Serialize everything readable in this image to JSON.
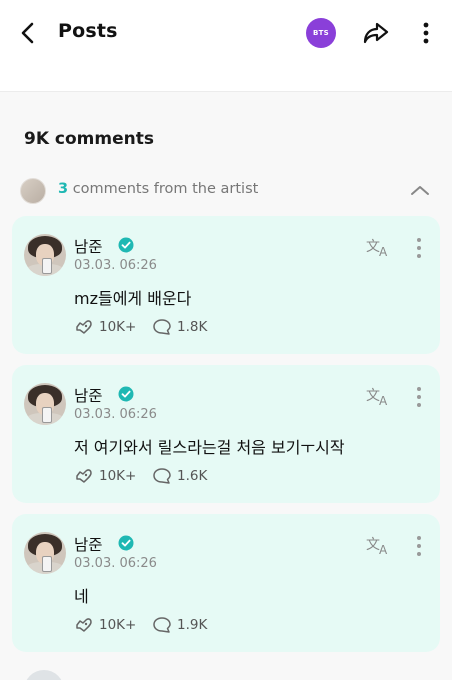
{
  "header": {
    "title": "Posts",
    "community_badge": "BTS",
    "back_icon": "chevron-left-icon",
    "share_icon": "share-arrow-icon",
    "more_icon": "vertical-dots-icon"
  },
  "comments_count": "9K comments",
  "artist_section": {
    "count": "3",
    "label": " comments from the artist",
    "accent_color": "#1fb8b3"
  },
  "comments": [
    {
      "name": "남준",
      "time": "03.03. 06:26",
      "text": "mz들에게 배운다",
      "likes": "10K+",
      "replies": "1.8K"
    },
    {
      "name": "남준",
      "time": "03.03. 06:26",
      "text": "저 여기와서 릴스라는걸 처음 보기ㅜ시작",
      "likes": "10K+",
      "replies": "1.6K"
    },
    {
      "name": "남준",
      "time": "03.03. 06:26",
      "text": "네",
      "likes": "10K+",
      "replies": "1.9K"
    }
  ],
  "colors": {
    "card_bg": "#e6faf5",
    "badge_bg": "#8a3fd9",
    "verified": "#1fb8b3"
  }
}
